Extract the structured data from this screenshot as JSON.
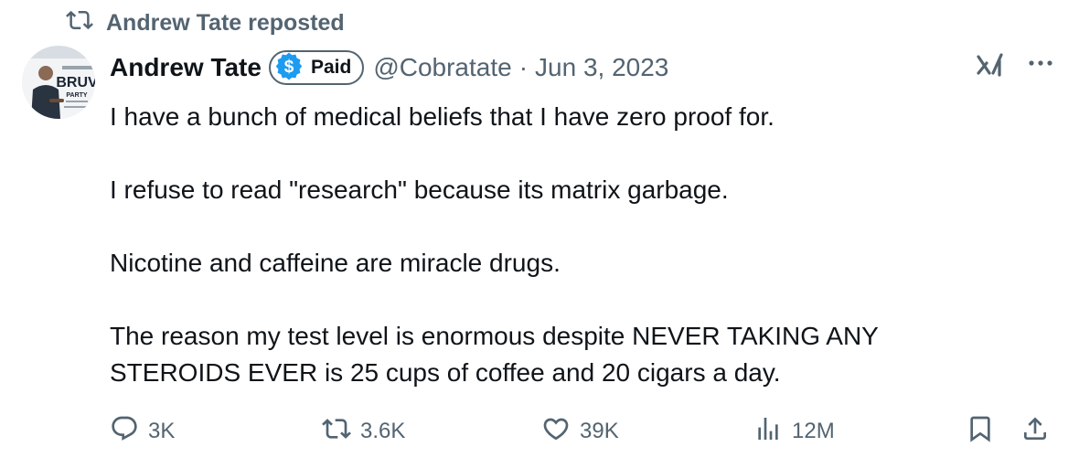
{
  "repost": {
    "text": "Andrew Tate reposted",
    "icon": "repost-icon"
  },
  "author": {
    "name": "Andrew Tate",
    "badge_label": "Paid",
    "badge_icon": "dollar-icon",
    "badge_color": "#1d9bf0",
    "handle": "@Cobratate",
    "separator": "·",
    "date": "Jun 3, 2023",
    "avatar_text": {
      "line1": "BRUV",
      "line2": "PARTY"
    }
  },
  "tweet": {
    "paragraphs": [
      "I have a bunch of medical beliefs that I have zero proof for.",
      "I refuse to read \"research\" because its matrix garbage.",
      "Nicotine and caffeine are miracle drugs.",
      "The reason my test level is enormous despite NEVER TAKING ANY STEROIDS EVER is 25 cups of coffee and 20 cigars a day."
    ]
  },
  "actions": {
    "reply": {
      "count": "3K",
      "icon": "reply-icon"
    },
    "repost": {
      "count": "3.6K",
      "icon": "repost-icon"
    },
    "like": {
      "count": "39K",
      "icon": "heart-icon"
    },
    "views": {
      "count": "12M",
      "icon": "views-icon"
    },
    "bookmark": {
      "icon": "bookmark-icon"
    },
    "share": {
      "icon": "share-icon"
    }
  },
  "colors": {
    "text_primary": "#0f1419",
    "text_secondary": "#536471",
    "brand_blue": "#1d9bf0"
  }
}
